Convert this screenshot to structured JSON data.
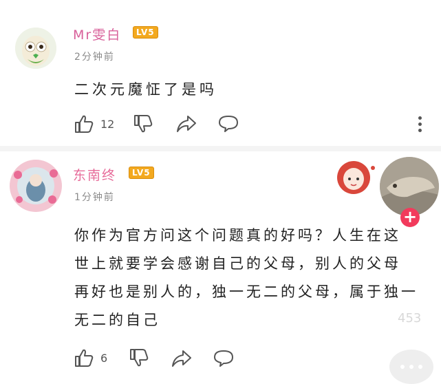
{
  "comments": [
    {
      "username": "Mr雯白",
      "level": "LV5",
      "time": "2分钟前",
      "text": "二次元魔怔了是吗",
      "like_count": "12",
      "name_color": "#d8609a"
    },
    {
      "username": "东南终",
      "level": "LV5",
      "time": "1分钟前",
      "lines": [
        "你作为官方问这个问题真的好吗？人生在这",
        "世上就要学会感谢自己的父母，别人的父母",
        "再好也是别人的，独一无二的父母，属于独一",
        "无二的自己"
      ],
      "like_count": "6",
      "name_color": "#e76c9a"
    }
  ],
  "overlay": {
    "plus": "+",
    "like_total": "453"
  },
  "colors": {
    "level_badge": "#f3a91f",
    "follow_button": "#f23a5c"
  }
}
